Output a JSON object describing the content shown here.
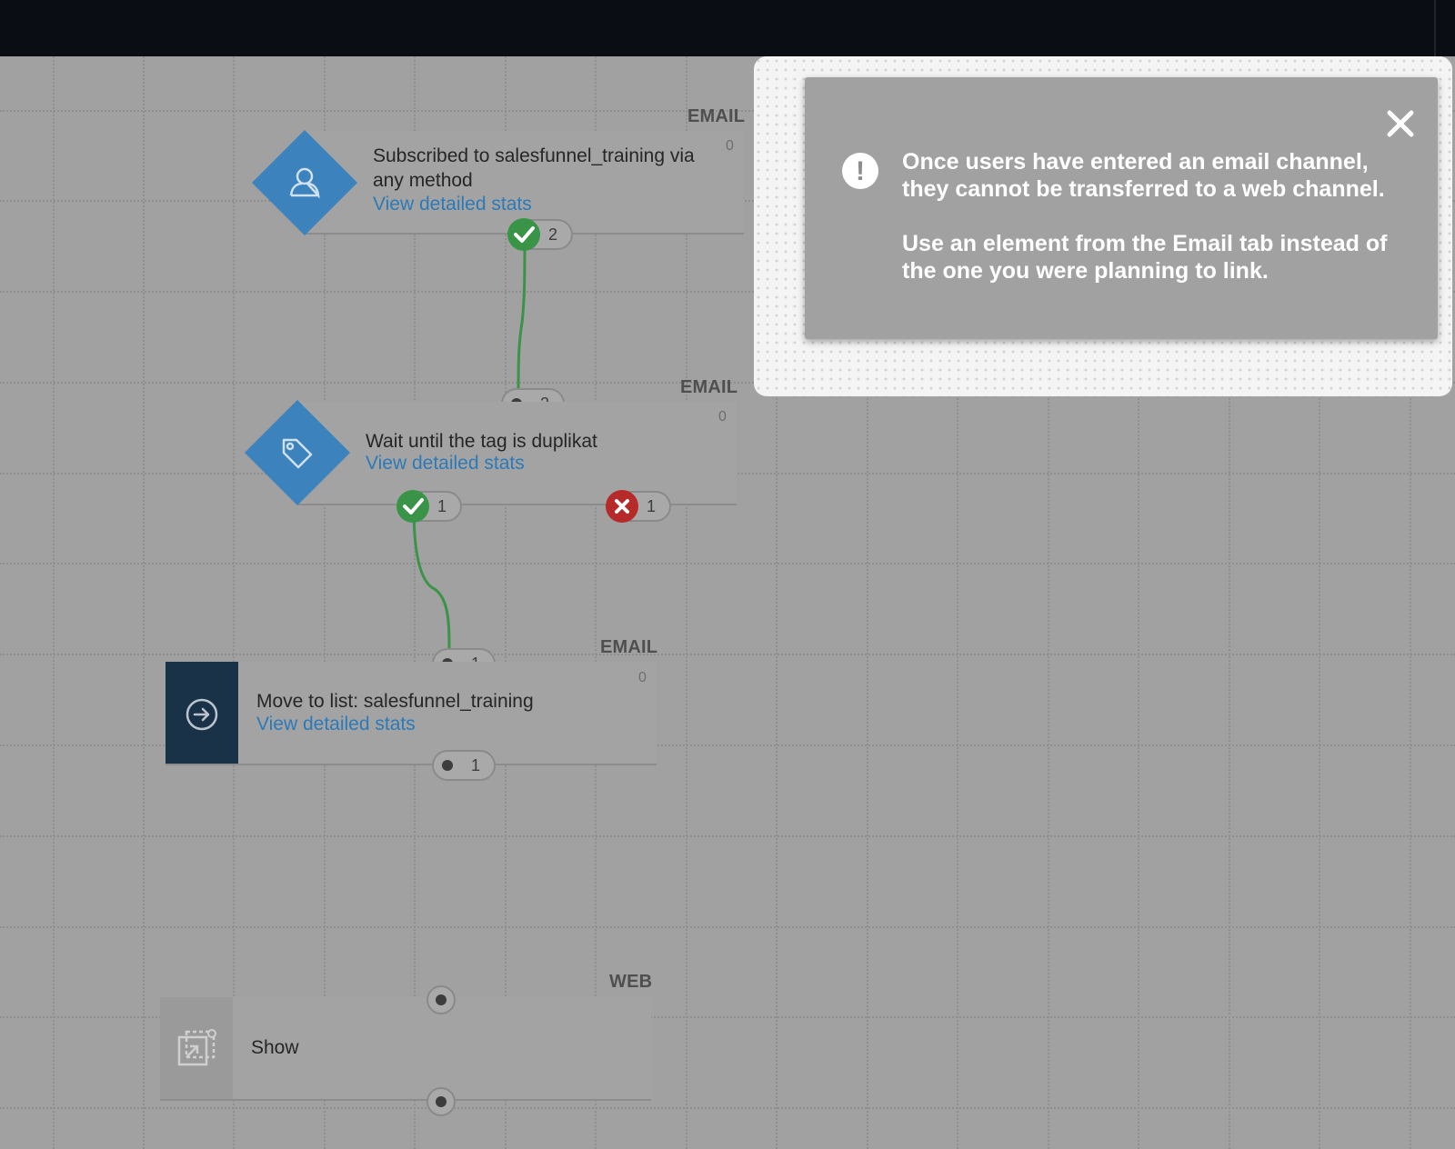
{
  "popup": {
    "message_line_1": "Once users have entered an email channel,",
    "message_line_2": "they cannot be transferred to a web channel.",
    "message_line_3": "Use an element from the Email tab instead of",
    "message_line_4": "the one you were planning to link.",
    "close_icon": "close-icon",
    "alert_icon": "exclamation-icon",
    "alert_glyph": "!"
  },
  "nodes": [
    {
      "channel": "EMAIL",
      "count": "0",
      "title_line_1": "Subscribed to salesfunnel_training via",
      "title_line_2": "any method",
      "link": "View detailed stats",
      "icon": "user-icon",
      "out_ports": [
        {
          "type": "success",
          "count": "2"
        }
      ]
    },
    {
      "channel": "EMAIL",
      "count": "0",
      "title": "Wait until the tag is duplikat",
      "link": "View detailed stats",
      "icon": "tag-icon",
      "in_port": {
        "count": "2"
      },
      "out_ports": [
        {
          "type": "success",
          "count": "1"
        },
        {
          "type": "failure",
          "count": "1"
        }
      ]
    },
    {
      "channel": "EMAIL",
      "count": "0",
      "title": "Move to list: salesfunnel_training",
      "link": "View detailed stats",
      "icon": "arrow-right-circle-icon",
      "in_port": {
        "count": "1"
      },
      "out_ports": [
        {
          "type": "neutral",
          "count": "1"
        }
      ]
    },
    {
      "channel": "WEB",
      "title": "Show",
      "icon": "popup-window-icon"
    }
  ],
  "colors": {
    "accent_blue": "#3c82bd",
    "link_blue": "#2c7ab8",
    "success_green": "#3a9447",
    "failure_red": "#b72a2a",
    "dark_navy": "#1a3248",
    "overlay_gray": "#a1a1a1"
  }
}
